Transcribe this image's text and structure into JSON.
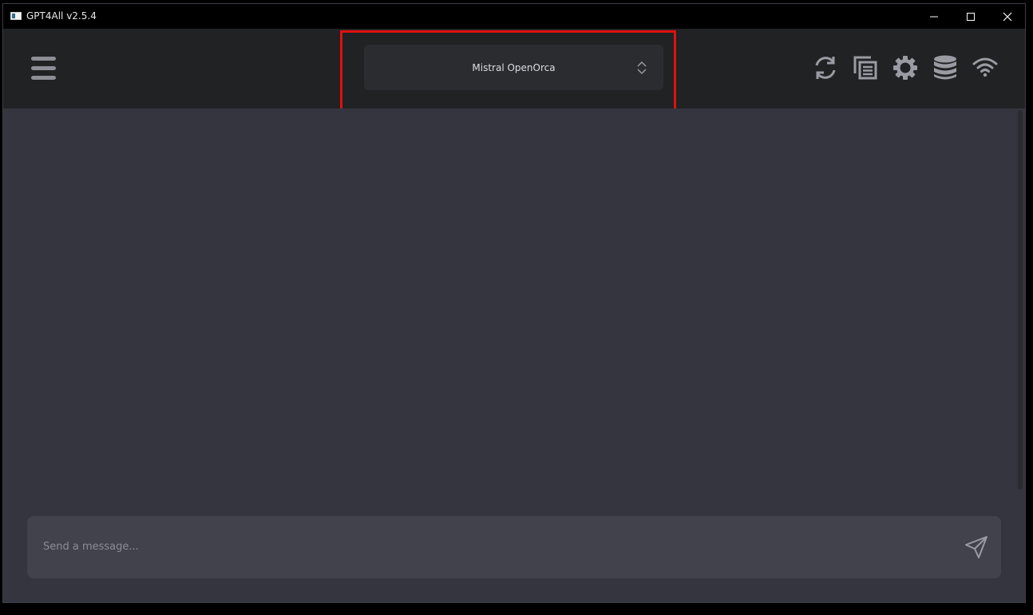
{
  "window": {
    "title": "GPT4All v2.5.4"
  },
  "header": {
    "model_selector": {
      "selected": "Mistral OpenOrca"
    },
    "icons": [
      "menu-icon",
      "reset-chat-icon",
      "copy-conversation-icon",
      "settings-icon",
      "database-icon",
      "network-icon"
    ]
  },
  "composer": {
    "placeholder": "Send a message..."
  },
  "colors": {
    "titlebar": "#000000",
    "toolbar": "#202224",
    "chat_bg": "#34353f",
    "input_bg": "#41424c",
    "highlight": "#e01010"
  }
}
